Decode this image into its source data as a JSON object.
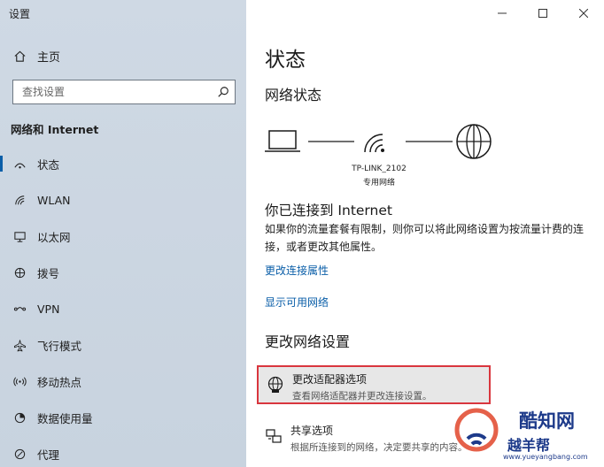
{
  "window": {
    "title": "设置",
    "controls": [
      "minimize-icon",
      "maximize-icon",
      "close-icon"
    ]
  },
  "sidebar": {
    "home_label": "主页",
    "search_placeholder": "查找设置",
    "section_title": "网络和 Internet",
    "items": [
      {
        "label": "状态",
        "icon": "status-icon",
        "selected": true
      },
      {
        "label": "WLAN",
        "icon": "wifi-icon",
        "selected": false
      },
      {
        "label": "以太网",
        "icon": "ethernet-icon",
        "selected": false
      },
      {
        "label": "拨号",
        "icon": "dialup-icon",
        "selected": false
      },
      {
        "label": "VPN",
        "icon": "vpn-icon",
        "selected": false
      },
      {
        "label": "飞行模式",
        "icon": "airplane-icon",
        "selected": false
      },
      {
        "label": "移动热点",
        "icon": "hotspot-icon",
        "selected": false
      },
      {
        "label": "数据使用量",
        "icon": "data-usage-icon",
        "selected": false
      },
      {
        "label": "代理",
        "icon": "proxy-icon",
        "selected": false
      }
    ]
  },
  "main": {
    "page_title": "状态",
    "network_status_title": "网络状态",
    "network_name": "TP-LINK_2102",
    "network_type": "专用网络",
    "connected_title": "你已连接到 Internet",
    "connected_desc": "如果你的流量套餐有限制，则你可以将此网络设置为按流量计费的连接，或者更改其他属性。",
    "link_change_props": "更改连接属性",
    "link_show_networks": "显示可用网络",
    "change_settings_title": "更改网络设置",
    "options": [
      {
        "title": "更改适配器选项",
        "desc": "查看网络适配器并更改连接设置。",
        "icon": "adapter-globe-icon",
        "highlighted": true
      },
      {
        "title": "共享选项",
        "desc": "根据所连接到的网络，决定要共享的内容。",
        "icon": "sharing-icon",
        "highlighted": false
      }
    ]
  },
  "watermark": {
    "brand_top": "酷知网",
    "brand_bottom": "越羊帮",
    "url": "www.yueyangbang.com"
  },
  "colors": {
    "accent": "#0a5ea8",
    "highlight_border": "#d9363e",
    "sidebar_bg": "#cfd9e4"
  }
}
